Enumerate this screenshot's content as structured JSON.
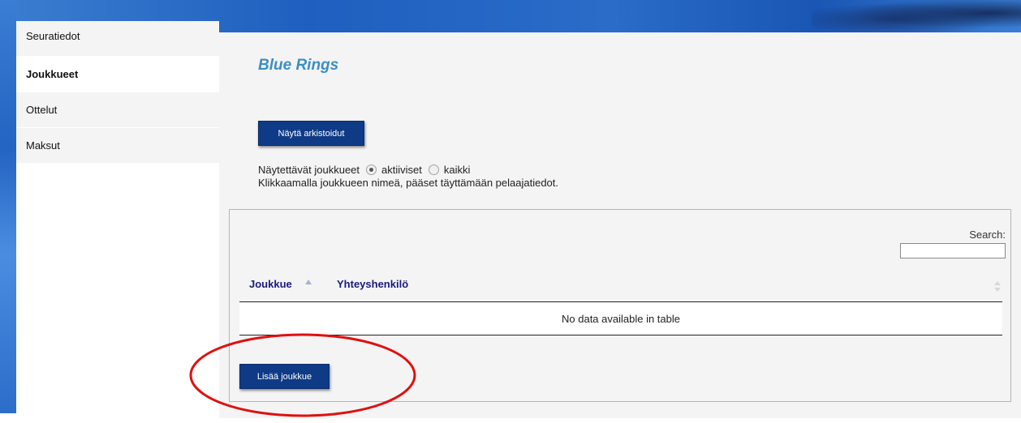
{
  "sidebar": {
    "items": [
      {
        "label": "Seuratiedot",
        "active": false
      },
      {
        "label": "Joukkueet",
        "active": true
      },
      {
        "label": "Ottelut",
        "active": false
      },
      {
        "label": "Maksut",
        "active": false
      }
    ]
  },
  "main": {
    "title": "Blue Rings",
    "show_archived_button": "Näytä arkistoidut",
    "filter": {
      "label": "Näytettävät joukkueet",
      "options": [
        {
          "label": "aktiiviset",
          "selected": true
        },
        {
          "label": "kaikki",
          "selected": false
        }
      ]
    },
    "info_text": "Klikkaamalla joukkueen nimeä, pääset täyttämään pelaajatiedot.",
    "table": {
      "search_label": "Search:",
      "search_value": "",
      "columns": [
        "Joukkue",
        "Yhteyshenkilö"
      ],
      "sorted_column": "Joukkue",
      "sort_direction": "ascending",
      "empty_message": "No data available in table"
    },
    "add_team_button": "Lisää joukkue"
  },
  "colors": {
    "title": "#3d8ec4",
    "button_bg": "#0e3a86",
    "column_header": "#1a1a7a",
    "highlight_ellipse": "#e01010"
  }
}
